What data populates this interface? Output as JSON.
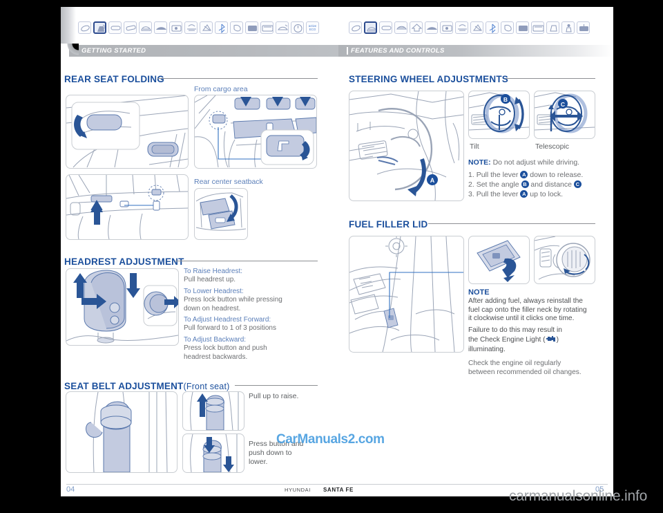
{
  "document": {
    "brand": "HYUNDAI",
    "model": "SANTA FE",
    "page_left": "04",
    "page_right": "05",
    "watermark_center": "CarManuals2.com",
    "watermark_bottom": "carmanualsonline.info"
  },
  "left_page": {
    "section_bar": "GETTING STARTED",
    "icons": [
      {
        "name": "key-icon",
        "selected": false
      },
      {
        "name": "seat-adjust-icon",
        "selected": true
      },
      {
        "name": "door-handle-icon",
        "selected": false
      },
      {
        "name": "mirror-icon",
        "selected": false
      },
      {
        "name": "steering-wheel-icon",
        "selected": false
      },
      {
        "name": "dashboard-icon",
        "selected": false
      },
      {
        "name": "instrument-cluster-icon",
        "selected": false
      },
      {
        "name": "climate-control-icon",
        "selected": false
      },
      {
        "name": "audio-system-icon",
        "selected": false
      },
      {
        "name": "bluetooth-icon",
        "selected": false
      },
      {
        "name": "phone-icon",
        "selected": false
      },
      {
        "name": "navigation-screen-icon",
        "selected": false
      },
      {
        "name": "display-screen-icon",
        "selected": false
      },
      {
        "name": "trunk-icon",
        "selected": false
      },
      {
        "name": "warning-lamp-icon",
        "selected": false
      },
      {
        "name": "active-eco-icon",
        "selected": false,
        "label": "active ECO"
      }
    ],
    "sections": [
      {
        "id": "rear-seat-folding",
        "title": "REAR SEAT FOLDING",
        "captions": [
          "From cargo area",
          "Rear center seatback"
        ]
      },
      {
        "id": "headrest-adjustment",
        "title": "HEADREST ADJUSTMENT",
        "items": [
          {
            "label": "To Raise Headrest:",
            "text": "Pull headrest up."
          },
          {
            "label": "To Lower Headrest:",
            "text": "Press lock button while pressing\ndown on headrest."
          },
          {
            "label": "To Adjust Headrest Forward:",
            "text": "Pull forward to 1 of 3 positions"
          },
          {
            "label": "To Adjust Backward:",
            "text": "Press lock button and push\nheadrest backwards."
          }
        ]
      },
      {
        "id": "seat-belt-adjustment",
        "title": "SEAT BELT ADJUSTMENT",
        "title_sub": "(Front seat)",
        "notes": [
          "Pull up to raise.",
          "Press button and\npush down to\nlower."
        ]
      }
    ]
  },
  "right_page": {
    "section_bar": "FEATURES AND CONTROLS",
    "icons": [
      {
        "name": "key-icon",
        "selected": false
      },
      {
        "name": "steering-wheel-icon",
        "selected": true
      },
      {
        "name": "door-handle-icon",
        "selected": false
      },
      {
        "name": "sunroof-icon",
        "selected": false
      },
      {
        "name": "home-icon",
        "selected": false
      },
      {
        "name": "dashboard-icon",
        "selected": false
      },
      {
        "name": "instrument-cluster-icon",
        "selected": false
      },
      {
        "name": "climate-control-icon",
        "selected": false
      },
      {
        "name": "audio-system-icon",
        "selected": false
      },
      {
        "name": "bluetooth-icon",
        "selected": false
      },
      {
        "name": "phone-icon",
        "selected": false
      },
      {
        "name": "navigation-screen-icon",
        "selected": false
      },
      {
        "name": "display-screen-icon",
        "selected": false
      },
      {
        "name": "seat-icon",
        "selected": false
      },
      {
        "name": "child-seat-icon",
        "selected": false
      },
      {
        "name": "cargo-icon",
        "selected": false
      }
    ],
    "sections": [
      {
        "id": "steering-wheel-adjustments",
        "title": "STEERING WHEEL ADJUSTMENTS",
        "fig_labels": [
          "Tilt",
          "Telescopic"
        ],
        "note_label": "NOTE:",
        "note_text": "Do not adjust while driving.",
        "steps": [
          {
            "num": "1.",
            "before": "Pull the lever",
            "badge": "A",
            "after": "down to release."
          },
          {
            "num": "2.",
            "before": "Set the angle",
            "badge": "B",
            "mid": "and distance",
            "badge2": "C",
            "after": ""
          },
          {
            "num": "3.",
            "before": "Pull the lever",
            "badge": "A",
            "after": "up to lock."
          }
        ],
        "diagram_badges": [
          "A",
          "B",
          "C"
        ]
      },
      {
        "id": "fuel-filler-lid",
        "title": "FUEL FILLER LID",
        "note_heading": "NOTE",
        "note_p1": "After adding fuel, always reinstall the\nfuel cap onto the filler neck by rotating\nit clockwise until it clicks one time.",
        "note_p2_a": "Failure to do this may result in",
        "note_p2_b": "the Check Engine Light (",
        "note_p2_icon": "check-engine-light-icon",
        "note_p2_c": ")",
        "note_p2_d": "illuminating.",
        "note_p3": "Check the engine oil regularly\nbetween recommended oil changes."
      }
    ]
  },
  "colors": {
    "heading_blue": "#1b4f9c",
    "caption_blue": "#5b7fb9",
    "body_grey": "#6d6f72",
    "illus_fill": "#c3cbe0",
    "illus_stroke": "#5b79ad",
    "arrow_blue": "#2a5596",
    "bar_grey": "#b0b3b7"
  }
}
